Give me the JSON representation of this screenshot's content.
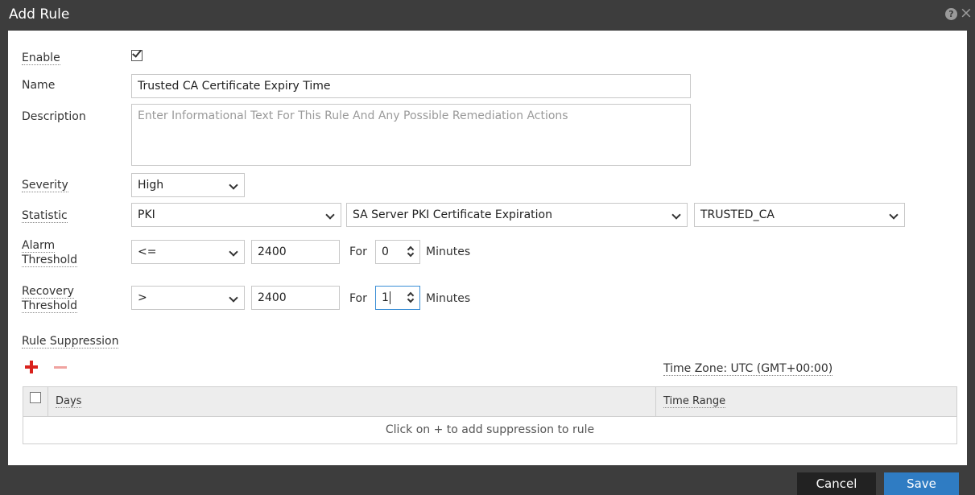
{
  "dialog": {
    "title": "Add Rule",
    "help_icon": "question-icon",
    "close_icon": "close-icon"
  },
  "form": {
    "enable": {
      "label": "Enable",
      "checked": true
    },
    "name": {
      "label": "Name",
      "value": "Trusted CA Certificate Expiry Time"
    },
    "description": {
      "label": "Description",
      "placeholder": "Enter Informational Text For This Rule And Any Possible Remediation Actions"
    },
    "severity": {
      "label": "Severity",
      "value": "High"
    },
    "statistic": {
      "label": "Statistic",
      "category": "PKI",
      "stat": "SA Server PKI Certificate Expiration",
      "instance": "TRUSTED_CA"
    },
    "alarm": {
      "label_line1": "Alarm",
      "label_line2": "Threshold",
      "operator": "<=",
      "value": "2400",
      "for_label": "For",
      "minutes": "0",
      "unit": "Minutes"
    },
    "recovery": {
      "label_line1": "Recovery",
      "label_line2": "Threshold",
      "operator": ">",
      "value": "2400",
      "for_label": "For",
      "minutes": "1",
      "unit": "Minutes"
    }
  },
  "suppression": {
    "label": "Rule Suppression",
    "timezone": "Time Zone: UTC (GMT+00:00)",
    "columns": [
      "Days",
      "Time Range"
    ],
    "empty_text": "Click on + to add suppression to rule"
  },
  "footer": {
    "cancel": "Cancel",
    "save": "Save"
  },
  "colors": {
    "titlebar": "#3d3d3d",
    "save": "#2f7cc3",
    "cancel": "#222222",
    "add": "#d9211c"
  }
}
